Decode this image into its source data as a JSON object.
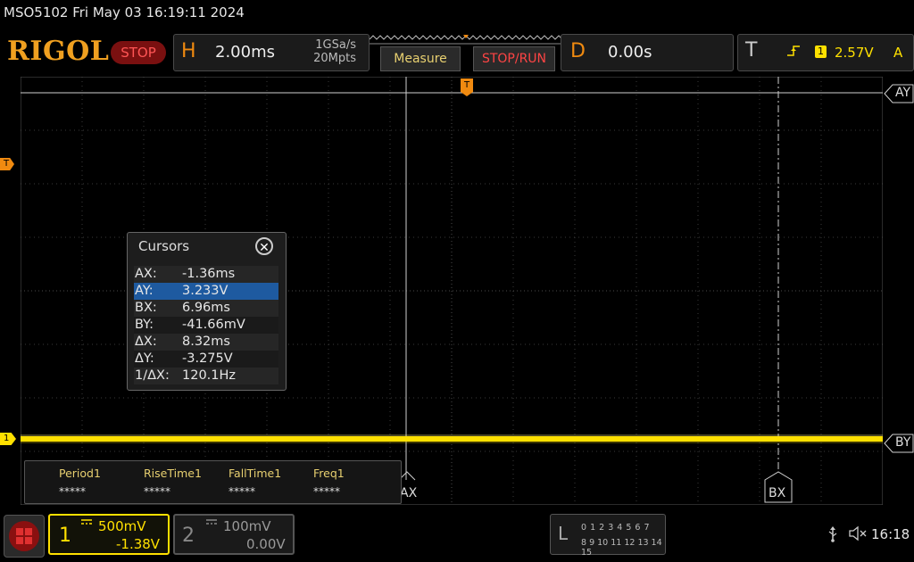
{
  "status_line": "MSO5102  Fri May 03 16:19:11 2024",
  "brand": "RIGOL",
  "run_state": "STOP",
  "horizontal": {
    "letter": "H",
    "timebase": "2.00ms",
    "sample_rate": "1GSa/s",
    "memory_depth": "20Mpts"
  },
  "buttons": {
    "measure": "Measure",
    "stop_run": "STOP/RUN"
  },
  "delay": {
    "letter": "D",
    "value": "0.00s"
  },
  "trigger": {
    "letter": "T",
    "channel": "1",
    "level": "2.57V",
    "mode": "A",
    "marker": "T"
  },
  "channel1_marker": "1",
  "cursor_labels": {
    "ay": "AY",
    "by": "BY",
    "ax": "AX",
    "bx": "BX"
  },
  "cursors": {
    "title": "Cursors",
    "close_glyph": "✕",
    "rows": [
      {
        "key": "AX:",
        "value": "-1.36ms"
      },
      {
        "key": "AY:",
        "value": "3.233V"
      },
      {
        "key": "BX:",
        "value": "6.96ms"
      },
      {
        "key": "BY:",
        "value": "-41.66mV"
      },
      {
        "key": "ΔX:",
        "value": "8.32ms"
      },
      {
        "key": "ΔY:",
        "value": "-3.275V"
      },
      {
        "key": "1/ΔX:",
        "value": "120.1Hz"
      }
    ],
    "selected_row": "AY:"
  },
  "measurements": [
    {
      "name": "Period1",
      "value": "*****"
    },
    {
      "name": "RiseTime1",
      "value": "*****"
    },
    {
      "name": "FallTime1",
      "value": "*****"
    },
    {
      "name": "Freq1",
      "value": "*****"
    }
  ],
  "channel1": {
    "number": "1",
    "coupling": "DC",
    "scale": "500mV",
    "offset": "-1.38V",
    "color": "#ffe000"
  },
  "channel2": {
    "number": "2",
    "coupling": "DC",
    "scale": "100mV",
    "offset": "0.00V"
  },
  "logic": {
    "letter": "L",
    "row1": "0 1 2 3  4 5 6 7",
    "row2": "8 9 10 11 12 13 14 15"
  },
  "icons": {
    "menu": "menu-grid-icon",
    "usb": "usb-icon",
    "speaker": "speaker-muted-icon"
  },
  "clock": "16:18",
  "colors": {
    "trigger": "#f08a10",
    "channel1": "#ffe000",
    "stop": "#ff4444",
    "brand": "#f0a020"
  }
}
